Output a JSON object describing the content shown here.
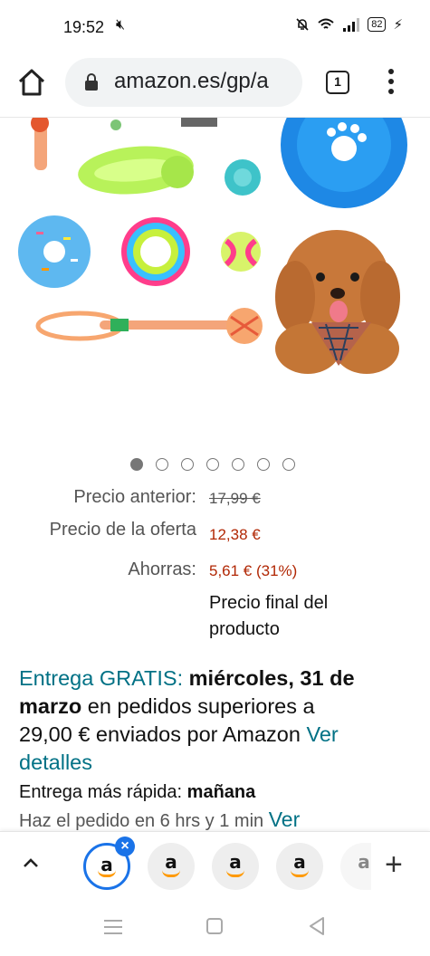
{
  "status_bar": {
    "time": "19:52",
    "battery": "82"
  },
  "browser": {
    "url": "amazon.es/gp/a",
    "tab_count": "1"
  },
  "carousel": {
    "total": 7,
    "active_index": 0
  },
  "price": {
    "previous_label": "Precio anterior:",
    "previous_value": "17,99 €",
    "deal_label": "Precio de la oferta",
    "deal_value": "12,38 €",
    "savings_label": "Ahorras:",
    "savings_value": "5,61 € (31%)",
    "final_note_line1": "Precio final del",
    "final_note_line2": "producto"
  },
  "delivery": {
    "free_label": "Entrega GRATIS:",
    "date_line": "miércoles, 31 de",
    "date_line2": "marzo",
    "text1": " en pedidos superiores a",
    "text2": "29,00 € enviados por Amazon ",
    "details_link_1": "Ver",
    "details_link_2": "detalles",
    "fastest_label": "Entrega más rápida: ",
    "fastest_value": "mañana",
    "order_by": "Haz el pedido en 6 hrs y 1 min ",
    "order_link": "Ver"
  },
  "tabs": {
    "items": [
      "a",
      "a",
      "a",
      "a",
      "a"
    ]
  },
  "colors": {
    "price_red": "#B12704",
    "link_teal": "#007185",
    "active_tab_blue": "#1a73e8"
  }
}
